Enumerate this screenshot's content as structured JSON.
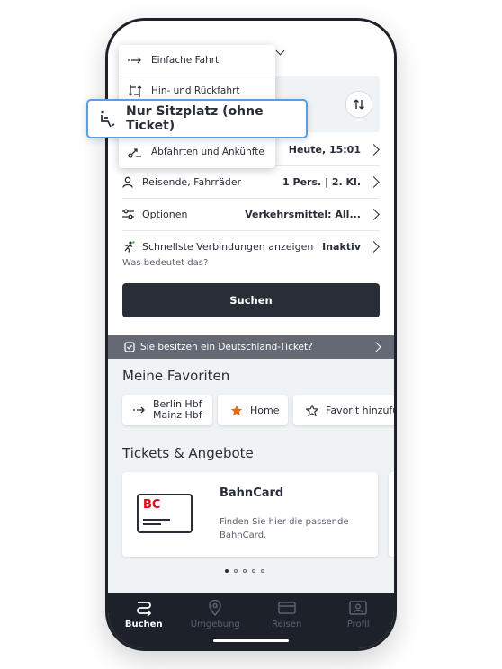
{
  "menu": {
    "items": [
      {
        "label": "Einfache Fahrt",
        "icon": "arrow-right-icon"
      },
      {
        "label": "Hin- und Rückfahrt",
        "icon": "round-trip-icon"
      },
      {
        "label": "Nur Sitzplatz (ohne Ticket)",
        "icon": "seat-icon"
      },
      {
        "label": "Abfahrten und Ankünfte",
        "icon": "departures-icon"
      }
    ]
  },
  "form": {
    "date_value": "Heute, 15:01",
    "travellers_label": "Reisende, Fahrräder",
    "travellers_value": "1 Pers. | 2. Kl.",
    "options_label": "Optionen",
    "options_value": "Verkehrsmittel: All...",
    "fastest_label": "Schnellste Verbindungen anzeigen",
    "fastest_value": "Inaktiv",
    "hint": "Was bedeutet das?",
    "search_label": "Suchen"
  },
  "banner": {
    "text": "Sie besitzen ein Deutschland-Ticket?"
  },
  "favorites": {
    "title": "Meine Favoriten",
    "chips": [
      {
        "line1": "Berlin Hbf",
        "line2": "Mainz Hbf"
      },
      {
        "label": "Home"
      },
      {
        "label": "Favorit hinzufüg"
      }
    ]
  },
  "offers": {
    "title": "Tickets & Angebote",
    "card": {
      "logo": "BC",
      "title": "BahnCard",
      "desc1": "Finden Sie hier die passende",
      "desc2": "BahnCard."
    },
    "page_count": 5,
    "active_page": 1
  },
  "tabs": [
    {
      "label": "Buchen",
      "icon": "route-icon",
      "active": true
    },
    {
      "label": "Umgebung",
      "icon": "location-pin-icon",
      "active": false
    },
    {
      "label": "Reisen",
      "icon": "ticket-icon",
      "active": false
    },
    {
      "label": "Profil",
      "icon": "profile-icon",
      "active": false
    }
  ],
  "colors": {
    "dark": "#282d37",
    "accent_red": "#ec0016",
    "highlight_blue": "#5b9ce6",
    "favorite_orange": "#e46b12"
  }
}
